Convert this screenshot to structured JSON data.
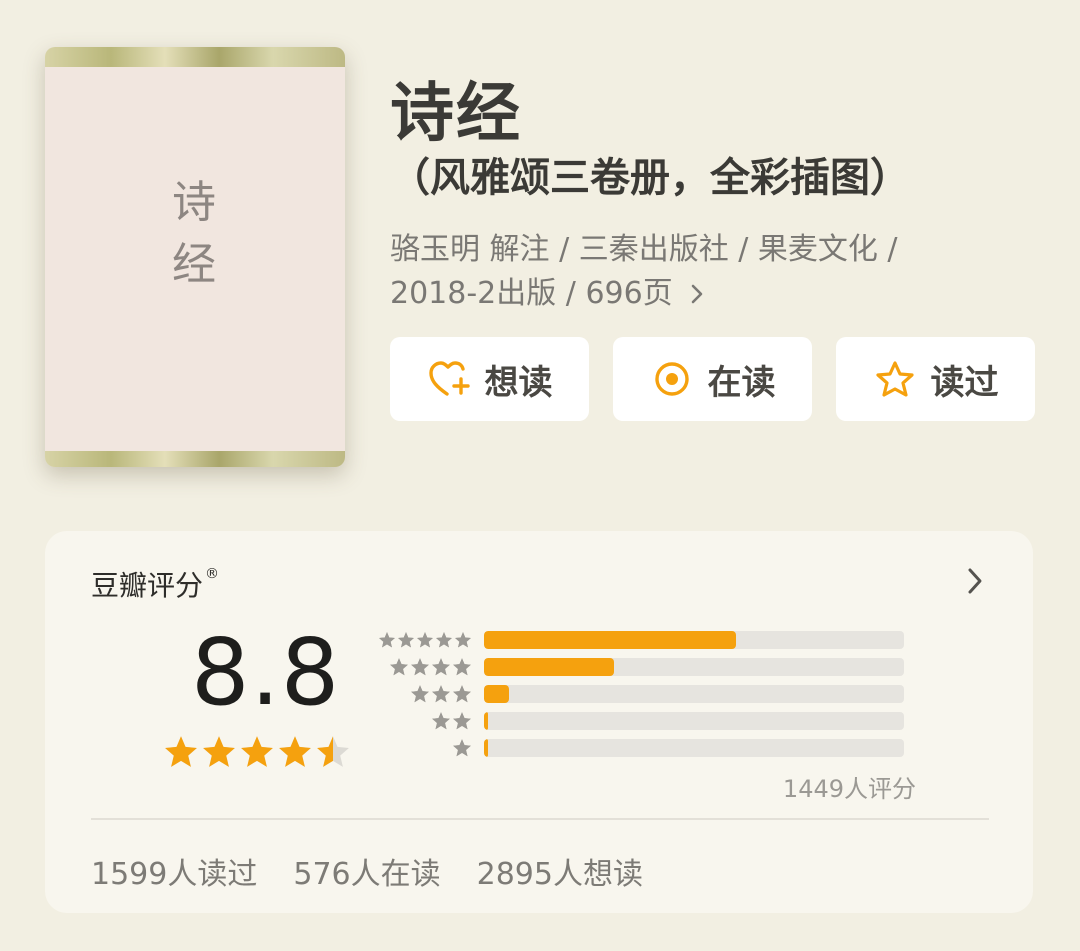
{
  "cover": {
    "title_line1": "诗",
    "title_line2": "经"
  },
  "book": {
    "title": "诗经",
    "subtitle": "（风雅颂三卷册，全彩插图）",
    "meta_line1": "骆玉明 解注 / 三秦出版社 / 果麦文化 /",
    "meta_line2": "2018-2出版 / 696页"
  },
  "actions": [
    {
      "label": "想读",
      "icon": "heart-plus-icon"
    },
    {
      "label": "在读",
      "icon": "target-circle-icon"
    },
    {
      "label": "读过",
      "icon": "star-outline-icon"
    }
  ],
  "rating": {
    "title": "豆瓣评分",
    "registered_mark": "®",
    "score": "8.8",
    "stars": 4.5,
    "distribution": [
      {
        "stars": 5,
        "fraction": 0.6
      },
      {
        "stars": 4,
        "fraction": 0.31
      },
      {
        "stars": 3,
        "fraction": 0.06
      },
      {
        "stars": 2,
        "fraction": 0.01
      },
      {
        "stars": 1,
        "fraction": 0.01
      }
    ],
    "raters": "1449人评分"
  },
  "stats": {
    "read": "1599人读过",
    "reading": "576人在读",
    "want": "2895人想读"
  },
  "colors": {
    "background": "#f2efe2",
    "accent": "#f5a10e",
    "star_gray": "#9b9994",
    "track": "#e6e4df"
  }
}
